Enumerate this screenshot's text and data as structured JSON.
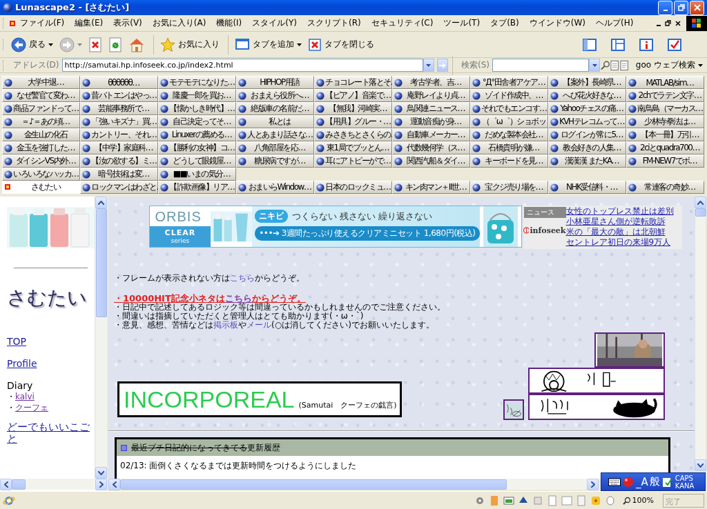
{
  "window": {
    "title": "Lunascape2 - [さむたい]"
  },
  "menu": [
    "ファイル(F)",
    "編集(E)",
    "表示(V)",
    "お気に入り(A)",
    "機能(I)",
    "スタイル(Y)",
    "スクリプト(R)",
    "セキュリティ(C)",
    "ツール(T)",
    "タブ(B)",
    "ウインドウ(W)",
    "ヘルプ(H)"
  ],
  "toolbar": {
    "back": "戻る",
    "favorites": "お気に入り",
    "add_tab": "タブを追加",
    "close_tab": "タブを閉じる"
  },
  "address_bar": {
    "label": "アドレス(D)",
    "url": "http://samutai.hp.infoseek.co.jp/index2.html",
    "search_label": "検索(S)",
    "search_engine": "goo ウェブ検索"
  },
  "tab_rows": [
    [
      {
        "label": "大学中退…",
        "selected": false
      },
      {
        "label": "θθθθθθ…",
        "selected": false
      },
      {
        "label": "モテモテになりた…",
        "selected": false
      },
      {
        "label": "HIPHOP用語",
        "selected": false
      },
      {
        "label": "チョコレート落とそ…",
        "selected": false
      },
      {
        "label": "考古学者、吉…",
        "selected": false
      },
      {
        "label": "°Д°田舎者アケア…",
        "selected": false
      },
      {
        "label": "【案外】長崎県…",
        "selected": false
      },
      {
        "label": "MATLAB/sim…",
        "selected": false
      }
    ],
    [
      {
        "label": "なぜ警官て変わ…",
        "selected": false
      },
      {
        "label": "昔バトエンはやっ…",
        "selected": false
      },
      {
        "label": "隆慶一郎を買お…",
        "selected": false
      },
      {
        "label": "おまえら役所へ…",
        "selected": false
      },
      {
        "label": "【ピアノ】音楽で…",
        "selected": false
      },
      {
        "label": "庵野レイより貞…",
        "selected": false
      },
      {
        "label": "ゾイド作成中、…",
        "selected": false
      },
      {
        "label": "へび花火好きな…",
        "selected": false
      },
      {
        "label": "2chでラテン文字…",
        "selected": false
      }
    ],
    [
      {
        "label": "商品ファンドって…",
        "selected": false
      },
      {
        "label": "芸能事務所で…",
        "selected": false
      },
      {
        "label": "【懐かしき時代】…",
        "selected": false
      },
      {
        "label": "絶版車の名前だ…",
        "selected": false
      },
      {
        "label": "【無我】河崎実…",
        "selected": false
      },
      {
        "label": "鳥関連ニュース…",
        "selected": false
      },
      {
        "label": "それでもエンコす…",
        "selected": false
      },
      {
        "label": "Yahooチェスの痛…",
        "selected": false
      },
      {
        "label": "南鳥島（マーカス…",
        "selected": false
      }
    ],
    [
      {
        "label": "＝♪＝あの頃…",
        "selected": false
      },
      {
        "label": "「強いキズナ」買…",
        "selected": false
      },
      {
        "label": "自己決定ってそ…",
        "selected": false
      },
      {
        "label": "私とは",
        "selected": false
      },
      {
        "label": "【用具】グルー・…",
        "selected": false
      },
      {
        "label": "運動音痴が身…",
        "selected": false
      },
      {
        "label": "（゜ω゜）ショボッ",
        "selected": false
      },
      {
        "label": "KVHテレコムって…",
        "selected": false
      },
      {
        "label": "少林寺拳法は…",
        "selected": false
      }
    ],
    [
      {
        "label": "金生山の化石",
        "selected": false
      },
      {
        "label": "カントリー、それ…",
        "selected": false
      },
      {
        "label": "Linuxerの薦める…",
        "selected": false
      },
      {
        "label": "人とあまり話さな…",
        "selected": false
      },
      {
        "label": "みさきちとさくらの…",
        "selected": false
      },
      {
        "label": "自動車メーカー…",
        "selected": false
      },
      {
        "label": "だめな製本会社…",
        "selected": false
      },
      {
        "label": "ログインが常に5…",
        "selected": false
      },
      {
        "label": "【本一冊】万引…",
        "selected": false
      }
    ],
    [
      {
        "label": "金玉を強打した…",
        "selected": false
      },
      {
        "label": "【中学】家庭科…",
        "selected": false
      },
      {
        "label": "【勝利の女神】コ…",
        "selected": false
      },
      {
        "label": "八角部屋を応…",
        "selected": false
      },
      {
        "label": "東1局でブッとん…",
        "selected": false
      },
      {
        "label": "代数幾何学（ス…",
        "selected": false
      },
      {
        "label": "石橋貴明が嫌…",
        "selected": false
      },
      {
        "label": "教会好きの人集…",
        "selected": false
      },
      {
        "label": "2ciとquadra700…",
        "selected": false
      }
    ],
    [
      {
        "label": "ダイシンVS内外…",
        "selected": false
      },
      {
        "label": "【汝の欲する】ミ…",
        "selected": false
      },
      {
        "label": "どうして眼鏡屋…",
        "selected": false
      },
      {
        "label": "糖尿病ですが…",
        "selected": false
      },
      {
        "label": "耳にアトピーがで…",
        "selected": false
      },
      {
        "label": "関西汽船＆ダイ…",
        "selected": false
      },
      {
        "label": "キーボードを見…",
        "selected": false
      },
      {
        "label": "漢漢漢 またKA…",
        "selected": false
      },
      {
        "label": "FM-NEW7でボ…",
        "selected": false
      }
    ],
    [
      {
        "label": "いろいろなハッカ…",
        "selected": false
      },
      {
        "label": "暗号技術は変…",
        "selected": false
      },
      {
        "label": "■■いまの気分…",
        "selected": false
      }
    ],
    [
      {
        "label": "さむたい",
        "selected": true
      },
      {
        "label": "ロックマンはわざと…",
        "selected": false
      },
      {
        "label": "【詐欺画像】リア…",
        "selected": false
      },
      {
        "label": "おまいらWindow…",
        "selected": false
      },
      {
        "label": "日本のロックミュ…",
        "selected": false
      },
      {
        "label": "キン肉マン＋Ⅱ世…",
        "selected": false
      },
      {
        "label": "宝クジ売り場を…",
        "selected": false
      },
      {
        "label": "NHK受信料・…",
        "selected": false
      },
      {
        "label": "常連客の奇妙…",
        "selected": false
      }
    ]
  ],
  "side_frame": {
    "logo": "さむたい",
    "items": [
      {
        "kind": "link",
        "text": "TOP"
      },
      {
        "kind": "link",
        "text": "Profile"
      },
      {
        "kind": "heading",
        "text": "Diary"
      },
      {
        "kind": "sublink",
        "bullet": "・",
        "text": "kalvi"
      },
      {
        "kind": "sublink",
        "bullet": "・",
        "text": "クーフェ"
      },
      {
        "kind": "link",
        "text": "どーでもいいこごと"
      }
    ]
  },
  "main_frame": {
    "ad": {
      "brand": "ORBIS",
      "series": "CLEAR",
      "series_sub": "series",
      "badge": "ニキビ",
      "headline": "つくらない 残さない 繰り返さない",
      "offer": "•••➔ 3週間たっぷり使えるクリアミニセット 1,680円(税込)"
    },
    "news": {
      "label": "ニュース",
      "source": "infoseek",
      "items": [
        "女性のトップレス禁止は差別",
        "小林亜星さん側が逆転敗訴",
        "米の「最大の敵」は北朝鮮",
        "セントレア初日の来場9万人"
      ]
    },
    "notices": [
      {
        "kind": "plain",
        "parts": [
          {
            "text": "・フレームが表示されない方は"
          },
          {
            "text": "こちら",
            "link": true
          },
          {
            "text": "からどうぞ。"
          }
        ]
      },
      {
        "kind": "highlight",
        "parts": [
          {
            "text": "・10000HIT記念小ネタは"
          },
          {
            "text": "こちら",
            "link": true
          },
          {
            "text": "からどうぞ。"
          }
        ]
      },
      {
        "kind": "plain",
        "parts": [
          {
            "text": "・日記中で記述してあるロジック等は間違っているかもしれませんのでご注意ください。"
          }
        ]
      },
      {
        "kind": "plain",
        "parts": [
          {
            "text": "・間違いは指摘していただくと管理人はとても助かります(・ω・`)"
          }
        ]
      },
      {
        "kind": "plain",
        "parts": [
          {
            "text": "・意見、感想、苦情などは"
          },
          {
            "text": "掲示板",
            "link": true
          },
          {
            "text": "や"
          },
          {
            "text": "メール",
            "link": true
          },
          {
            "text": "(○は消してください)でお願いいたします。"
          }
        ]
      }
    ],
    "title_box": {
      "title": "INCORPOREAL",
      "subtitle": "(Samutai　クーフェの戯言)"
    },
    "updates": {
      "title_struck": "最近プチ日記的になってきてる",
      "title": "更新履歴",
      "entries": [
        "02/13: 面倒くさくなるまでは更新時間をつけるようにしました"
      ]
    }
  },
  "ime_bar": {
    "mode": "_A",
    "dictionary": "般",
    "caps": "CAPS",
    "kana": "KANA"
  },
  "status_bar": {
    "zoom": "100%",
    "status": "完了"
  }
}
